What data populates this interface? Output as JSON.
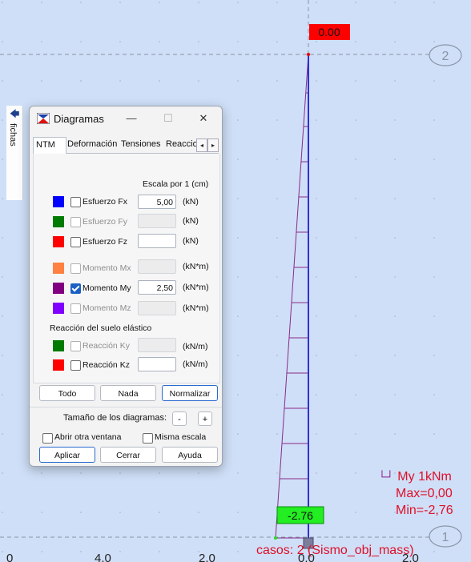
{
  "window": {
    "title": "Diagramas",
    "minimize_glyph": "—",
    "maximize_glyph": "☐",
    "close_glyph": "✕"
  },
  "side_tab": {
    "label": "fichas"
  },
  "tabs": [
    {
      "label": "NTM",
      "active": true
    },
    {
      "label": "Deformación"
    },
    {
      "label": "Tensiones"
    },
    {
      "label": "Reaccio"
    }
  ],
  "tab_scroll": {
    "left": "◂",
    "right": "▸"
  },
  "scale_header": "Escala por 1  (cm)",
  "rows": [
    {
      "label": "Esfuerzo Fx",
      "color": "#0000ff",
      "checked": false,
      "enabled": true,
      "value": "5,00",
      "unit": "(kN)"
    },
    {
      "label": "Esfuerzo Fy",
      "color": "#007a00",
      "checked": false,
      "enabled": false,
      "value": "",
      "unit": "(kN)"
    },
    {
      "label": "Esfuerzo Fz",
      "color": "#ff0000",
      "checked": false,
      "enabled": true,
      "value": "",
      "unit": "(kN)"
    },
    {
      "label": "Momento Mx",
      "color": "#ff8040",
      "checked": false,
      "enabled": false,
      "value": "",
      "unit": "(kN*m)"
    },
    {
      "label": "Momento My",
      "color": "#800080",
      "checked": true,
      "enabled": true,
      "value": "2,50",
      "unit": "(kN*m)"
    },
    {
      "label": "Momento Mz",
      "color": "#8000ff",
      "checked": false,
      "enabled": false,
      "value": "",
      "unit": "(kN*m)"
    }
  ],
  "soil_header": "Reacción del suelo elástico",
  "soil_rows": [
    {
      "label": "Reacción Ky",
      "color": "#007a00",
      "checked": false,
      "enabled": false,
      "value": "",
      "unit": "(kN/m)"
    },
    {
      "label": "Reacción Kz",
      "color": "#ff0000",
      "checked": false,
      "enabled": true,
      "value": "",
      "unit": "(kN/m)"
    }
  ],
  "buttons": {
    "todo": "Todo",
    "nada": "Nada",
    "normalizar": "Normalizar",
    "size_label": "Tamaño de los diagramas:",
    "minus": "-",
    "plus": "+",
    "abrir": "Abrir otra ventana",
    "misma": "Misma escala",
    "aplicar": "Aplicar",
    "cerrar": "Cerrar",
    "ayuda": "Ayuda"
  },
  "canvas": {
    "top_value": "0.00",
    "bottom_value": "-2.76",
    "axis_label_top": "2",
    "axis_label_bottom": "1",
    "tick_labels": [
      "0",
      "4.0",
      "2.0",
      "0.0",
      "2.0"
    ],
    "legend": {
      "symbol": "└┘",
      "title": "My  1kNm",
      "max": "Max=0,00",
      "min": "Min=-2,76"
    },
    "casos": "casos: 2 (Sismo_obj_mass)",
    "colors": {
      "background": "#cfdff7",
      "member": "#2f2fd8",
      "moment": "#8a2a8a",
      "positive": "#e6000a",
      "negative": "#22dd22"
    }
  }
}
